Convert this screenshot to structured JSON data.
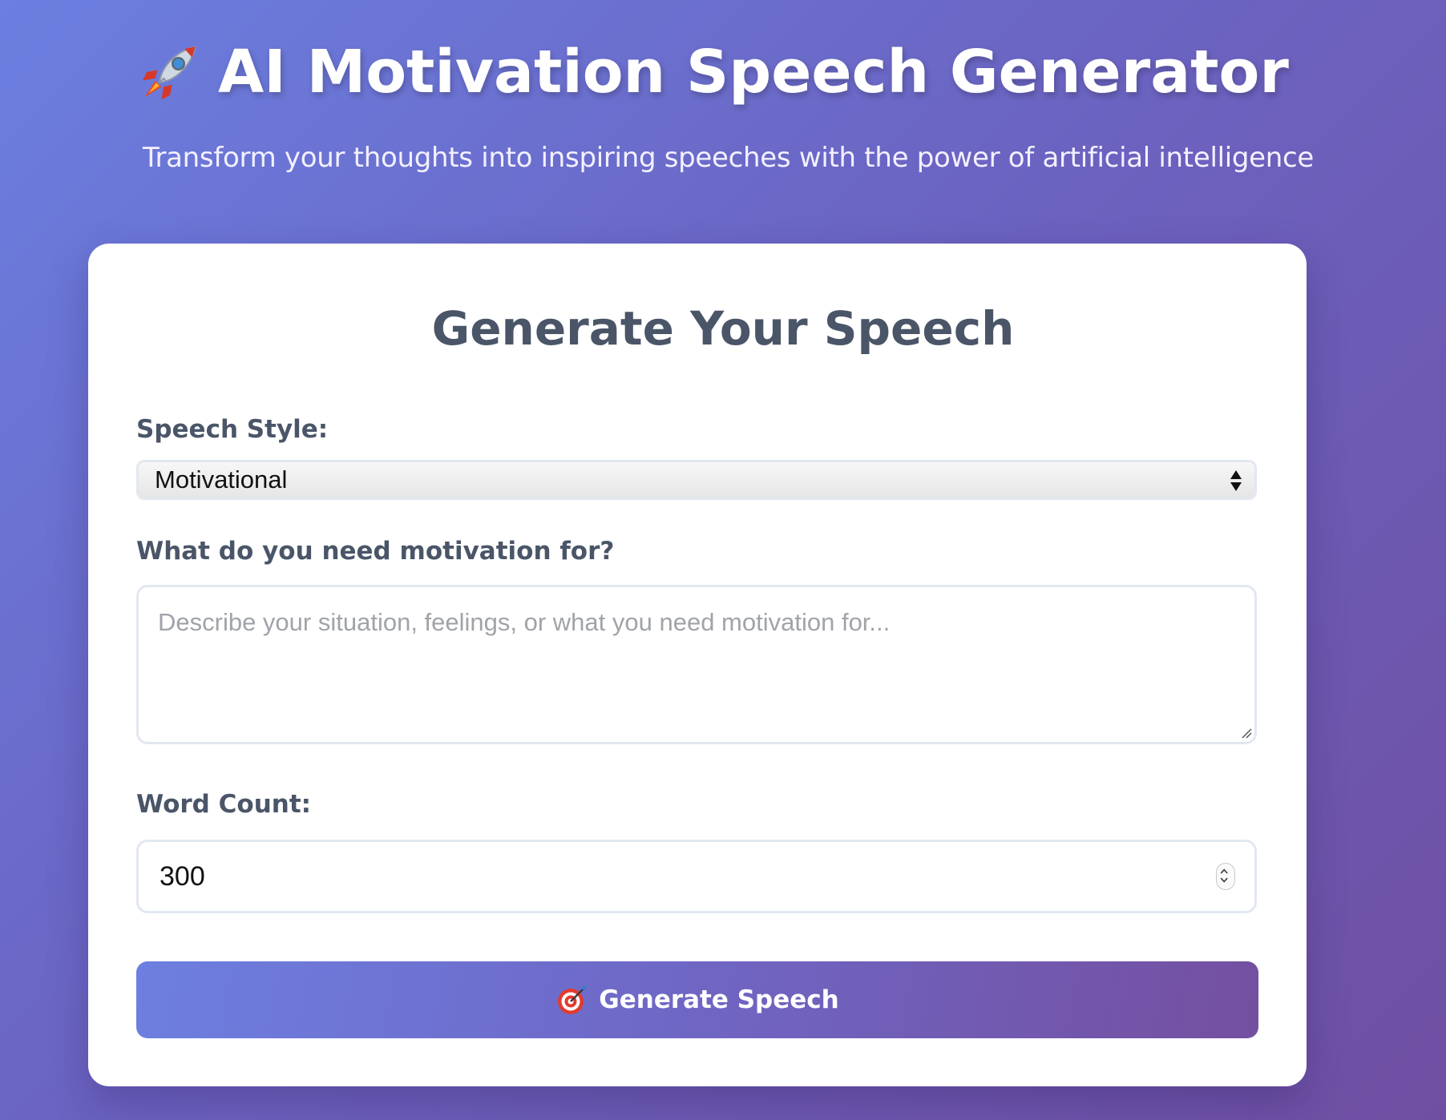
{
  "header": {
    "icon": "rocket-icon",
    "title": "AI Motivation Speech Generator",
    "subtitle": "Transform your thoughts into inspiring speeches with the power of artificial intelligence"
  },
  "form": {
    "heading": "Generate Your Speech",
    "style_label": "Speech Style:",
    "style_value": "Motivational",
    "need_label": "What do you need motivation for?",
    "need_value": "",
    "need_placeholder": "Describe your situation, feelings, or what you need motivation for...",
    "count_label": "Word Count:",
    "count_value": "300",
    "submit_icon": "dart-target-icon",
    "submit_label": "Generate Speech"
  },
  "colors": {
    "background_start": "#6b7fe0",
    "background_end": "#6f4fa2",
    "card": "#ffffff",
    "label": "#4a5568",
    "input_border": "#e2e8f0"
  }
}
